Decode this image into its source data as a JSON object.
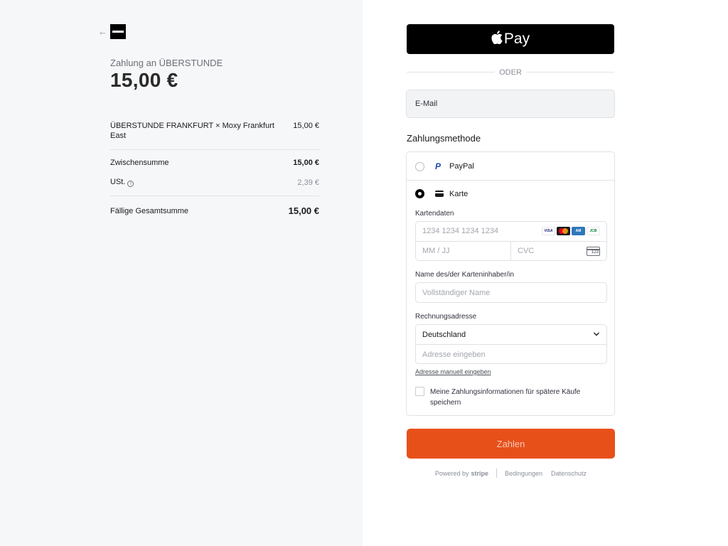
{
  "summary": {
    "pay_to": "Zahlung an ÜBERSTUNDE",
    "amount": "15,00 €",
    "line_item": {
      "name": "ÜBERSTUNDE FRANKFURT × Moxy Frankfurt East",
      "price": "15,00 €"
    },
    "subtotal": {
      "label": "Zwischensumme",
      "value": "15,00 €"
    },
    "tax": {
      "label": "USt.",
      "value": "2,39 €"
    },
    "total": {
      "label": "Fällige Gesamtsumme",
      "value": "15,00 €"
    }
  },
  "checkout": {
    "apple_pay_label": "Pay",
    "separator": "ODER",
    "email_label": "E-Mail",
    "payment_method_title": "Zahlungsmethode",
    "paypal_label": "PayPal",
    "card_label": "Karte",
    "card_details_label": "Kartendaten",
    "card_number_placeholder": "1234 1234 1234 1234",
    "expiry_placeholder": "MM / JJ",
    "cvc_placeholder": "CVC",
    "cvc_icon_text": "123",
    "brands": {
      "visa": "VISA",
      "amex": "AM",
      "jcb": "JCB"
    },
    "cardholder_label": "Name des/der Karteninhaber/in",
    "cardholder_placeholder": "Vollständiger Name",
    "billing_label": "Rechnungsadresse",
    "country": "Deutschland",
    "address_placeholder": "Adresse eingeben",
    "manual_address_link": "Adresse manuell eingeben",
    "save_info_text": "Meine Zahlungsinformationen für spätere Käufe speichern",
    "pay_button": "Zahlen",
    "selected_method": "card",
    "accent_color": "#e8501a"
  },
  "footer": {
    "powered_by": "Powered by",
    "stripe": "stripe",
    "terms": "Bedingungen",
    "privacy": "Datenschutz"
  }
}
